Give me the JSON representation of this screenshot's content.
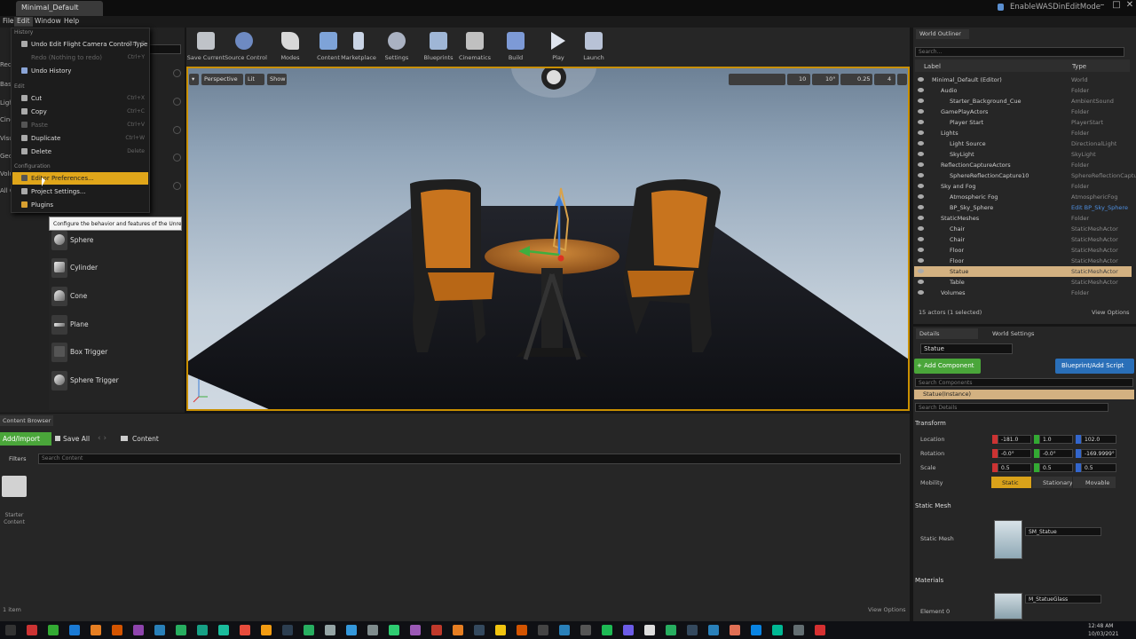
{
  "window": {
    "doc_tab": "Minimal_Default",
    "project_name": "EnableWASDinEditMode"
  },
  "menubar": {
    "items": [
      "File",
      "Edit",
      "Window",
      "Help"
    ]
  },
  "toolbar": {
    "buttons": [
      "Save Current",
      "Source Control",
      "Modes",
      "Content",
      "Marketplace",
      "Settings",
      "Blueprints",
      "Cinematics",
      "Build",
      "Play",
      "Launch"
    ]
  },
  "edit_menu": {
    "history_header": "History",
    "undo": "Undo Edit Flight Camera Control Type",
    "undo_shortcut": "Ctrl+Z",
    "redo": "Redo (Nothing to redo)",
    "redo_shortcut": "Ctrl+Y",
    "undo_history": "Undo History",
    "edit_header": "Edit",
    "cut": "Cut",
    "cut_shortcut": "Ctrl+X",
    "copy": "Copy",
    "copy_shortcut": "Ctrl+C",
    "paste": "Paste",
    "paste_shortcut": "Ctrl+V",
    "duplicate": "Duplicate",
    "duplicate_shortcut": "Ctrl+W",
    "delete": "Delete",
    "delete_shortcut": "Delete",
    "config_header": "Configuration",
    "editor_prefs": "Editor Preferences...",
    "project_settings": "Project Settings...",
    "plugins": "Plugins"
  },
  "tooltip": "Configure the behavior and features of the Unreal Editor.",
  "left_panel": {
    "categories": [
      "Recen",
      "Basic",
      "Light",
      "Cinem",
      "Visua",
      "Geom",
      "Volum",
      "All Cl"
    ],
    "primitives": [
      "Sphere",
      "Cylinder",
      "Cone",
      "Plane",
      "Box Trigger",
      "Sphere Trigger"
    ]
  },
  "viewport": {
    "perspective": "Perspective",
    "lit": "Lit",
    "show": "Show",
    "grid_size": "10",
    "angle": "10°",
    "scale": "0.25",
    "cam_speed": "4"
  },
  "outliner": {
    "tab": "World Outliner",
    "search_placeholder": "Search...",
    "col_label": "Label",
    "col_type": "Type",
    "rows": [
      {
        "label": "Minimal_Default (Editor)",
        "type": "World"
      },
      {
        "label": "Audio",
        "type": "Folder"
      },
      {
        "label": "Starter_Background_Cue",
        "type": "AmbientSound"
      },
      {
        "label": "GamePlayActors",
        "type": "Folder"
      },
      {
        "label": "Player Start",
        "type": "PlayerStart"
      },
      {
        "label": "Lights",
        "type": "Folder"
      },
      {
        "label": "Light Source",
        "type": "DirectionalLight"
      },
      {
        "label": "SkyLight",
        "type": "SkyLight"
      },
      {
        "label": "ReflectionCaptureActors",
        "type": "Folder"
      },
      {
        "label": "SphereReflectionCapture10",
        "type": "SphereReflectionCapture"
      },
      {
        "label": "Sky and Fog",
        "type": "Folder"
      },
      {
        "label": "Atmospheric Fog",
        "type": "AtmosphericFog"
      },
      {
        "label": "BP_Sky_Sphere",
        "type": "Edit BP_Sky_Sphere"
      },
      {
        "label": "StaticMeshes",
        "type": "Folder"
      },
      {
        "label": "Chair",
        "type": "StaticMeshActor"
      },
      {
        "label": "Chair",
        "type": "StaticMeshActor"
      },
      {
        "label": "Floor",
        "type": "StaticMeshActor"
      },
      {
        "label": "Floor",
        "type": "StaticMeshActor"
      },
      {
        "label": "Statue",
        "type": "StaticMeshActor"
      },
      {
        "label": "Table",
        "type": "StaticMeshActor"
      },
      {
        "label": "Volumes",
        "type": "Folder"
      }
    ],
    "status": "15 actors (1 selected)",
    "view_options": "View Options"
  },
  "details": {
    "tab": "Details",
    "world_settings_tab": "World Settings",
    "actor_name": "Statue",
    "add_component": "+ Add Component",
    "blueprint_btn": "Blueprint/Add Script",
    "search_components": "Search Components",
    "instance": "Statue(Instance)",
    "search_details": "Search Details",
    "transform_header": "Transform",
    "location_label": "Location",
    "rotation_label": "Rotation",
    "scale_label": "Scale",
    "mobility_label": "Mobility",
    "location": [
      "-181.0",
      "1.0",
      "102.0"
    ],
    "rotation": [
      "-0.0°",
      "-0.0°",
      "-169.9999°"
    ],
    "scale": [
      "0.5",
      "0.5",
      "0.5"
    ],
    "mobility": [
      "Static",
      "Stationary",
      "Movable"
    ],
    "static_mesh_header": "Static Mesh",
    "static_mesh_label": "Static Mesh",
    "static_mesh_value": "SM_Statue",
    "materials_header": "Materials",
    "element_label": "Element 0",
    "material_value": "M_StatueGlass"
  },
  "content_browser": {
    "tab": "Content Browser",
    "add_import": "Add/Import",
    "save_all": "Save All",
    "path": "Content",
    "filters": "Filters",
    "search_placeholder": "Search Content",
    "folder": "Starter Content",
    "count": "1 item",
    "view_options": "View Options"
  },
  "taskbar": {
    "time": "12:48 AM",
    "date": "10/03/2021"
  }
}
